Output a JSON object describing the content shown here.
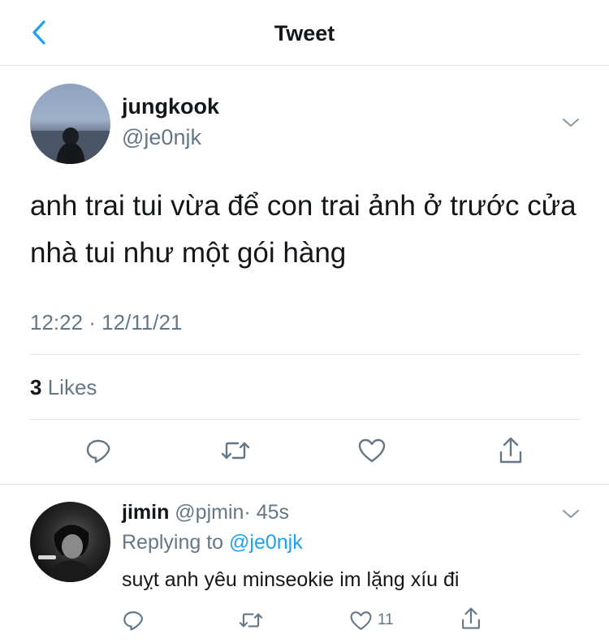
{
  "header": {
    "title": "Tweet",
    "back_icon": "chevron-left-icon",
    "accent": "#1da1f2"
  },
  "tweet": {
    "name": "jungkook",
    "handle": "@je0njk",
    "text": "anh trai tui vừa để con trai ảnh ở trước cửa nhà tui như một gói hàng",
    "timestamp": "12:22 · 12/11/21",
    "likes_count": "3",
    "likes_label": "Likes",
    "actions": [
      "reply-icon",
      "retweet-icon",
      "like-icon",
      "share-icon"
    ]
  },
  "reply": {
    "name": "jimin",
    "handle": "@pjmin",
    "age": "· 45s",
    "replying_prefix": "Replying to",
    "replying_to": "@je0njk",
    "text": "suỵt anh yêu minseokie im lặng xíu đi",
    "like_count": "11"
  },
  "colors": {
    "text": "#14171a",
    "secondary": "#657786",
    "divider": "#e3e6e8",
    "link": "#1da1f2"
  }
}
